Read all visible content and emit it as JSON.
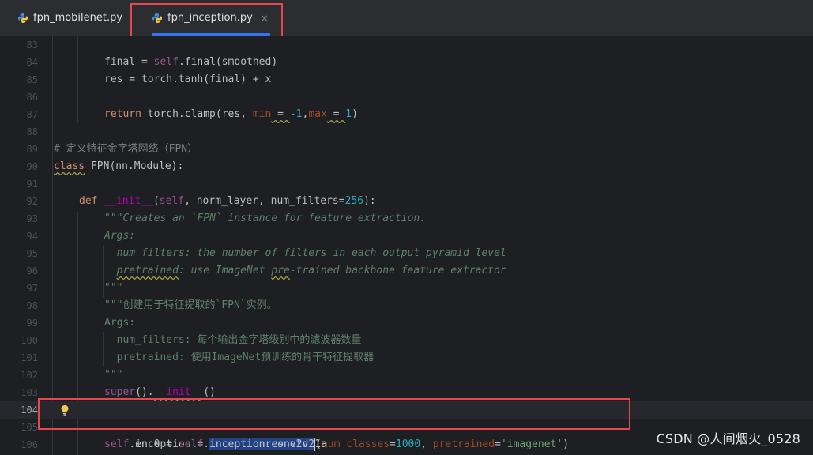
{
  "tabs": [
    {
      "label": "fpn_mobilenet.py",
      "active": false
    },
    {
      "label": "fpn_inception.py",
      "active": true,
      "close": "×"
    }
  ],
  "lines": [
    {
      "n": "83"
    },
    {
      "n": "84",
      "p": [
        "final = ",
        "self",
        ".final(smoothed)"
      ]
    },
    {
      "n": "85",
      "p": [
        "res = torch.tanh(final) + x"
      ]
    },
    {
      "n": "86"
    },
    {
      "n": "87",
      "p": [
        "return",
        " torch.clamp(res, ",
        "min",
        " = ",
        "-1",
        ",",
        "max",
        " = ",
        "1",
        ")"
      ]
    },
    {
      "n": "88"
    },
    {
      "n": "89",
      "p": [
        "# 定义特征金字塔网络（FPN）"
      ]
    },
    {
      "n": "90",
      "p": [
        "class",
        " ",
        "FPN",
        "(nn.Module):"
      ]
    },
    {
      "n": "91"
    },
    {
      "n": "92",
      "p": [
        "def",
        " ",
        "__init__",
        "(",
        "self",
        ", norm_layer, num_filters=",
        "256",
        "):"
      ]
    },
    {
      "n": "93",
      "p": [
        "\"\"\"Creates an `FPN` instance for feature extraction."
      ]
    },
    {
      "n": "94",
      "p": [
        "Args:"
      ]
    },
    {
      "n": "95",
      "p": [
        "  num_filters: the number of filters in each output pyramid level"
      ]
    },
    {
      "n": "96",
      "p": [
        "  ",
        "pretrained",
        ": use ImageNet ",
        "pre",
        "-trained backbone feature extractor"
      ]
    },
    {
      "n": "97",
      "p": [
        "\"\"\""
      ]
    },
    {
      "n": "98",
      "p": [
        "\"\"\"创建用于特征提取的`FPN`实例。"
      ]
    },
    {
      "n": "99",
      "p": [
        "Args:"
      ]
    },
    {
      "n": "100",
      "p": [
        "  num_filters: 每个输出金字塔级别中的滤波器数量"
      ]
    },
    {
      "n": "101",
      "p": [
        "  pretrained: 使用ImageNet预训练的骨干特征提取器"
      ]
    },
    {
      "n": "102",
      "p": [
        "\"\"\""
      ]
    },
    {
      "n": "103",
      "p": [
        "super",
        "().",
        "__init__",
        "()"
      ]
    },
    {
      "n": "104",
      "p": [
        "self",
        ".inception = ",
        "inceptionresnetv2",
        "(",
        "num_classes",
        "=",
        "1000",
        ", ",
        "pretrained",
        "=",
        "'imagenet'",
        ")"
      ]
    },
    {
      "n": "105"
    },
    {
      "n": "106",
      "p": [
        "self",
        ".enc0 = ",
        "self",
        ".inception.conv2d_1a"
      ]
    }
  ],
  "watermark": "CSDN @人间烟火_0528",
  "colors": {
    "highlight_box": "#e5484d",
    "accent": "#3574f0"
  }
}
